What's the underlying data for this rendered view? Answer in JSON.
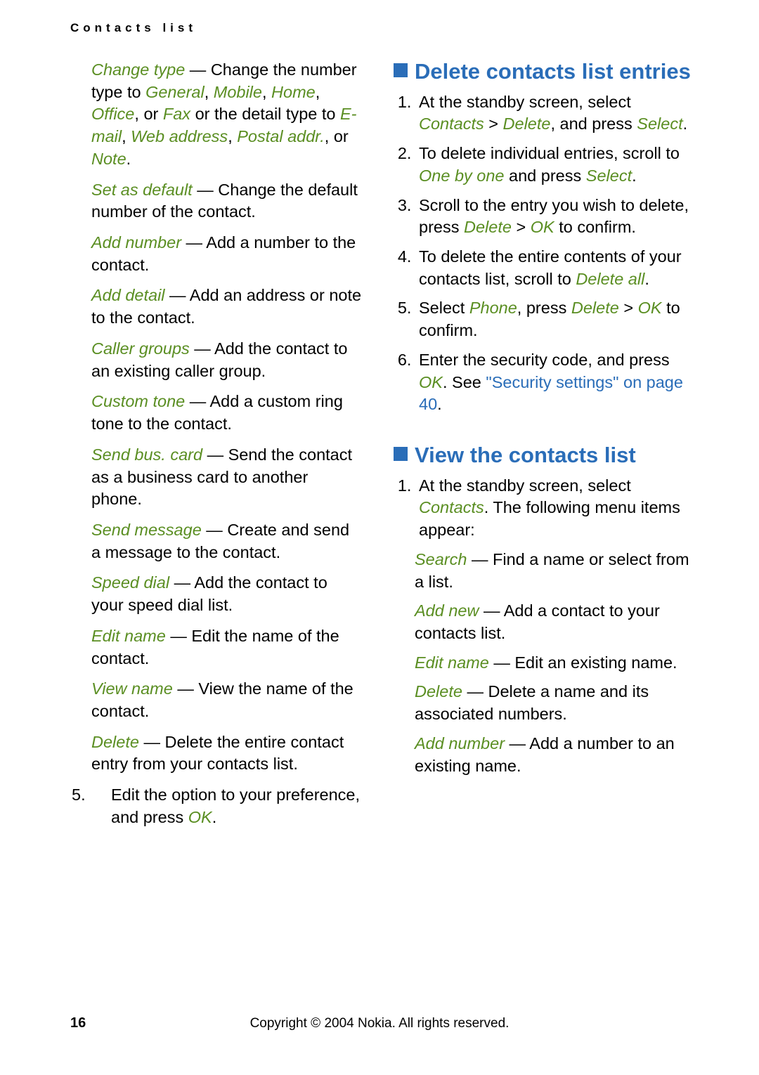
{
  "header": "Contacts list",
  "page_number": "16",
  "copyright": "Copyright © 2004 Nokia. All rights reserved.",
  "left": {
    "change_type": {
      "label": "Change type",
      "t1": " — Change the number type to ",
      "g": "General",
      "c1": ", ",
      "m": "Mobile",
      "c2": ", ",
      "h": "Home",
      "c3": ", ",
      "o": "Office",
      "t2": ", or ",
      "f": "Fax",
      "t3": " or the detail type to ",
      "e": "E-mail",
      "c4": ", ",
      "w": "Web address",
      "c5": ", ",
      "p": "Postal addr.",
      "t4": ", or ",
      "n": "Note",
      "end": "."
    },
    "set_default": {
      "label": "Set as default",
      "text": " — Change the default number of the contact."
    },
    "add_number": {
      "label": "Add number",
      "text": " — Add a number to the contact."
    },
    "add_detail": {
      "label": "Add detail",
      "text": " — Add an address or note to the contact."
    },
    "caller_groups": {
      "label": "Caller groups",
      "text": " — Add the contact to an existing caller group."
    },
    "custom_tone": {
      "label": "Custom tone",
      "text": " — Add a custom ring tone to the contact."
    },
    "send_bus": {
      "label": "Send bus. card",
      "text": " — Send the contact as a business card to another phone."
    },
    "send_msg": {
      "label": "Send message",
      "text": " — Create and send a message to the contact."
    },
    "speed_dial": {
      "label": "Speed dial",
      "text": " — Add the contact to your speed dial list."
    },
    "edit_name": {
      "label": "Edit name",
      "text": " — Edit the name of the contact."
    },
    "view_name": {
      "label": "View name",
      "text": " — View the name of the contact."
    },
    "delete": {
      "label": "Delete",
      "text": " — Delete the entire contact entry from your contacts list."
    },
    "step5": {
      "t1": "Edit the option to your preference, and press ",
      "ok": "OK",
      "end": "."
    }
  },
  "right": {
    "h_delete": "Delete contacts list entries",
    "d1": {
      "t1": "At the standby screen, select ",
      "c": "Contacts",
      "gt": " > ",
      "d": "Delete",
      "t2": ", and press ",
      "s": "Select",
      "end": "."
    },
    "d2": {
      "t1": "To delete individual entries, scroll to ",
      "o": "One by one",
      "t2": " and press ",
      "s": "Select",
      "end": "."
    },
    "d3": {
      "t1": "Scroll to the entry you wish to delete, press ",
      "d": "Delete",
      "gt": " > ",
      "ok": "OK",
      "t2": " to confirm."
    },
    "d4": {
      "t1": "To delete the entire contents of your contacts list, scroll to ",
      "da": "Delete all",
      "end": "."
    },
    "d5": {
      "t1": "Select ",
      "p": "Phone",
      "t2": ", press ",
      "d": "Delete",
      "gt": " > ",
      "ok": "OK",
      "t3": " to confirm."
    },
    "d6": {
      "t1": "Enter the security code, and press ",
      "ok": "OK",
      "t2": ". See ",
      "link": "\"Security settings\" on page 40",
      "end": "."
    },
    "h_view": "View the contacts list",
    "v1": {
      "t1": "At the standby screen, select ",
      "c": "Contacts",
      "t2": ". The following menu items appear:"
    },
    "search": {
      "label": "Search",
      "text": " — Find a name or select from a list."
    },
    "add_new": {
      "label": "Add new",
      "text": " — Add a contact to your contacts list."
    },
    "edit_name": {
      "label": "Edit name",
      "text": " — Edit an existing name."
    },
    "delete": {
      "label": "Delete",
      "text": " — Delete a name and its associated numbers."
    },
    "add_number": {
      "label": "Add number",
      "text": " — Add a number to an existing name."
    }
  }
}
